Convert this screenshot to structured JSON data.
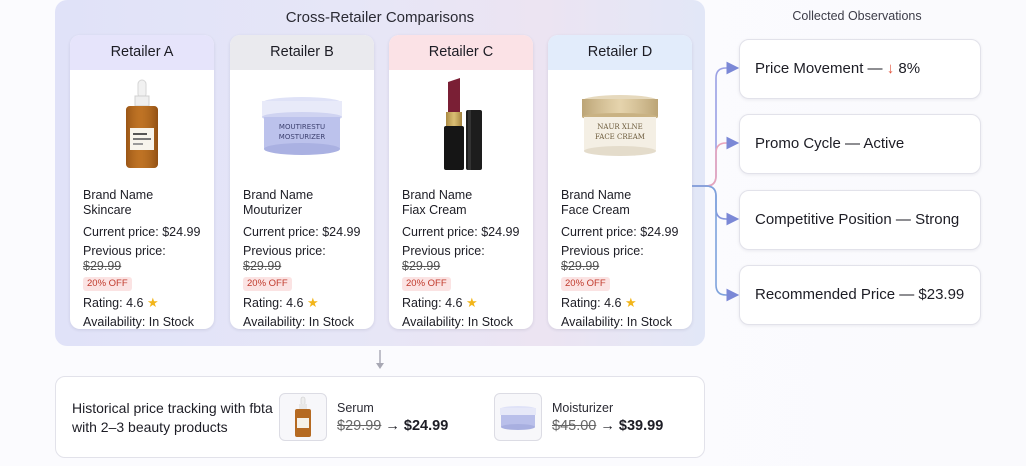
{
  "comparison": {
    "title": "Cross-Retailer Comparisons",
    "labels": {
      "current": "Current price:",
      "previous": "Previous price:",
      "rating": "Rating:",
      "availability": "Availability:"
    },
    "retailers": [
      {
        "name": "Retailer A",
        "header_color": "#e6e4fb",
        "product_line1": "Brand Name",
        "product_line2": "Skincare",
        "current_price": "$24.99",
        "previous_price": "$29.99",
        "discount": "20% OFF",
        "rating": "4.6",
        "availability": "In Stock",
        "product_icon": "serum-bottle-icon"
      },
      {
        "name": "Retailer B",
        "header_color": "#eaeaee",
        "product_line1": "Brand Name",
        "product_line2": "Mouturizer",
        "current_price": "$24.99",
        "previous_price": "$29.99",
        "discount": "20% OFF",
        "rating": "4.6",
        "availability": "In Stock",
        "product_icon": "moisturizer-jar-icon",
        "jar_label_line1": "MOUTIRESTU",
        "jar_label_line2": "MOSTURIZER"
      },
      {
        "name": "Retailer C",
        "header_color": "#fbe2e6",
        "product_line1": "Brand Name",
        "product_line2": "Fiax Cream",
        "current_price": "$24.99",
        "previous_price": "$29.99",
        "discount": "20% OFF",
        "rating": "4.6",
        "availability": "In Stock",
        "product_icon": "lipstick-icon"
      },
      {
        "name": "Retailer D",
        "header_color": "#e2ecfb",
        "product_line1": "Brand Name",
        "product_line2": "Face Cream",
        "current_price": "$24.99",
        "previous_price": "$29.99",
        "discount": "20% OFF",
        "rating": "4.6",
        "availability": "In Stock",
        "product_icon": "face-cream-jar-icon",
        "jar_label_line1": "NAUR XLNE",
        "jar_label_line2": "FACE CREAM"
      }
    ]
  },
  "observations": {
    "title": "Collected Observations",
    "items": [
      {
        "label": "Price Movement —",
        "arrow": "↓",
        "value": "8%"
      },
      {
        "label": "Promo Cycle — Active"
      },
      {
        "label": "Competitive Position — Strong"
      },
      {
        "label": "Recommended Price — $23.99"
      }
    ],
    "connector_colors": [
      "#8c8fe0",
      "#e79bb3",
      "#7a8fd8",
      "#6f9ad8"
    ]
  },
  "history": {
    "description": "Historical price tracking with fbta with 2–3 beauty products",
    "products": [
      {
        "name": "Serum",
        "old_price": "$29.99",
        "arrow": "→",
        "new_price": "$24.99",
        "icon": "serum-bottle-icon"
      },
      {
        "name": "Moisturizer",
        "old_price": "$45.00",
        "arrow": "→",
        "new_price": "$39.99",
        "icon": "moisturizer-jar-icon"
      }
    ]
  }
}
